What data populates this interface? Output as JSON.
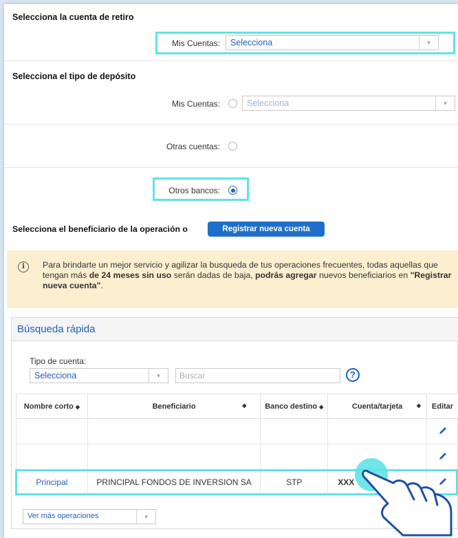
{
  "withdrawal": {
    "title": "Selecciona la cuenta de retiro",
    "label": "Mis Cuentas:",
    "value": "Selecciona"
  },
  "deposit": {
    "title": "Selecciona el tipo de depósito",
    "mis_cuentas_label": "Mis Cuentas:",
    "mis_cuentas_value": "Selecciona",
    "otras_cuentas_label": "Otras cuentas:",
    "otros_bancos_label": "Otros bancos:"
  },
  "beneficiary": {
    "title": "Selecciona el beneficiario de la operación o",
    "register_button": "Registrar nueva cuenta"
  },
  "notice": {
    "part1": "Para brindarte un mejor servicio y agilizar la busqueda de tus operaciones frecuentes, todas aquellas que tengan más ",
    "bold1": "de 24 meses sin uso",
    "part2": " serán dadas de baja, ",
    "bold2": "podrás agregar",
    "part3": " nuevos beneficiarios en ",
    "bold3": "\"Registrar nueva cuenta\"",
    "part4": "."
  },
  "search": {
    "title": "Búsqueda rápida",
    "account_type_label": "Tipo de cuenta:",
    "account_type_value": "Selecciona",
    "search_placeholder": "Buscar",
    "help": "?"
  },
  "table": {
    "headers": {
      "short_name": "Nombre corto",
      "beneficiary": "Beneficiario",
      "bank": "Banco destino",
      "account": "Cuenta/tarjeta",
      "edit": "Editar"
    },
    "row3": {
      "short_name": "Principal",
      "beneficiary": "PRINCIPAL FONDOS DE INVERSION SA",
      "bank": "STP",
      "account": "XXX"
    }
  },
  "more_ops": {
    "label": "Ver más operaciones"
  },
  "colors": {
    "highlight": "#5fe3e7",
    "primary": "#1e6fc9",
    "link": "#1f5fb8",
    "notice_bg": "#fbefd0"
  }
}
